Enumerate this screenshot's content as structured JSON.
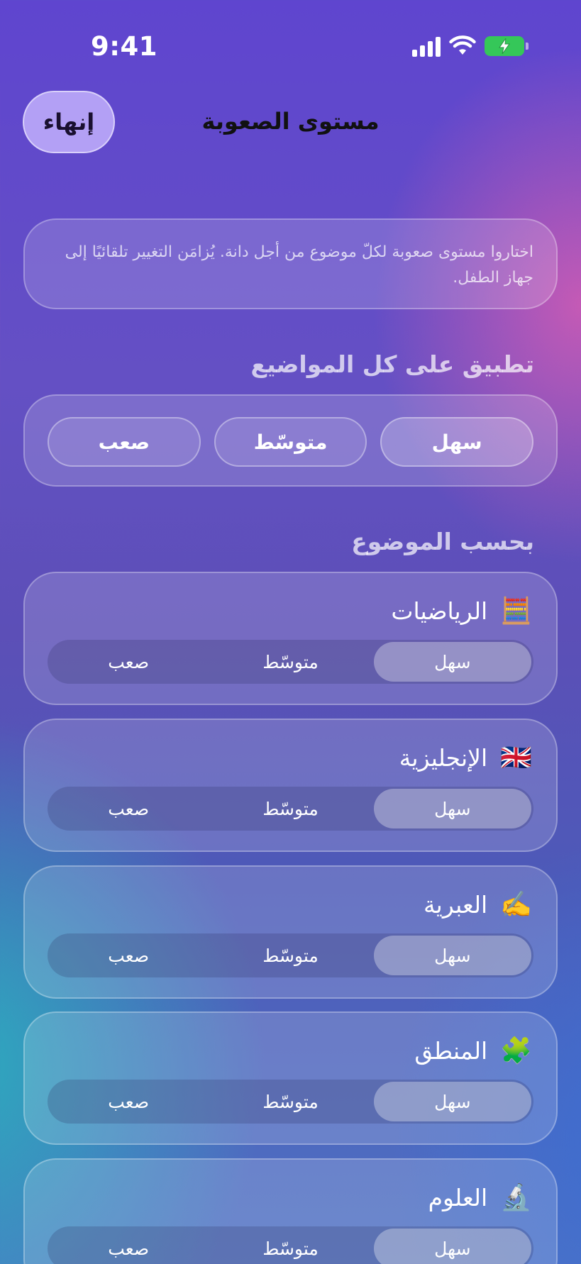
{
  "status": {
    "time": "9:41"
  },
  "nav": {
    "done_label": "إنهاء",
    "title": "مستوى الصعوبة"
  },
  "info": {
    "text": "اختاروا مستوى صعوبة لكلّ موضوع من أجل دانة. يُزامَن التغيير تلقائيًا إلى جهاز الطفل."
  },
  "apply_all": {
    "title": "تطبيق على كل المواضيع",
    "options": [
      "سهل",
      "متوسّط",
      "صعب"
    ]
  },
  "by_subject": {
    "title": "بحسب الموضوع",
    "options": [
      "سهل",
      "متوسّط",
      "صعب"
    ],
    "subjects": [
      {
        "name": "الرياضيات",
        "icon": "🧮",
        "selected": "سهل"
      },
      {
        "name": "الإنجليزية",
        "icon": "🇬🇧",
        "selected": "سهل"
      },
      {
        "name": "العبرية",
        "icon": "✍️",
        "selected": "سهل"
      },
      {
        "name": "المنطق",
        "icon": "🧩",
        "selected": "سهل"
      },
      {
        "name": "العلوم",
        "icon": "🔬",
        "selected": "سهل"
      }
    ]
  }
}
